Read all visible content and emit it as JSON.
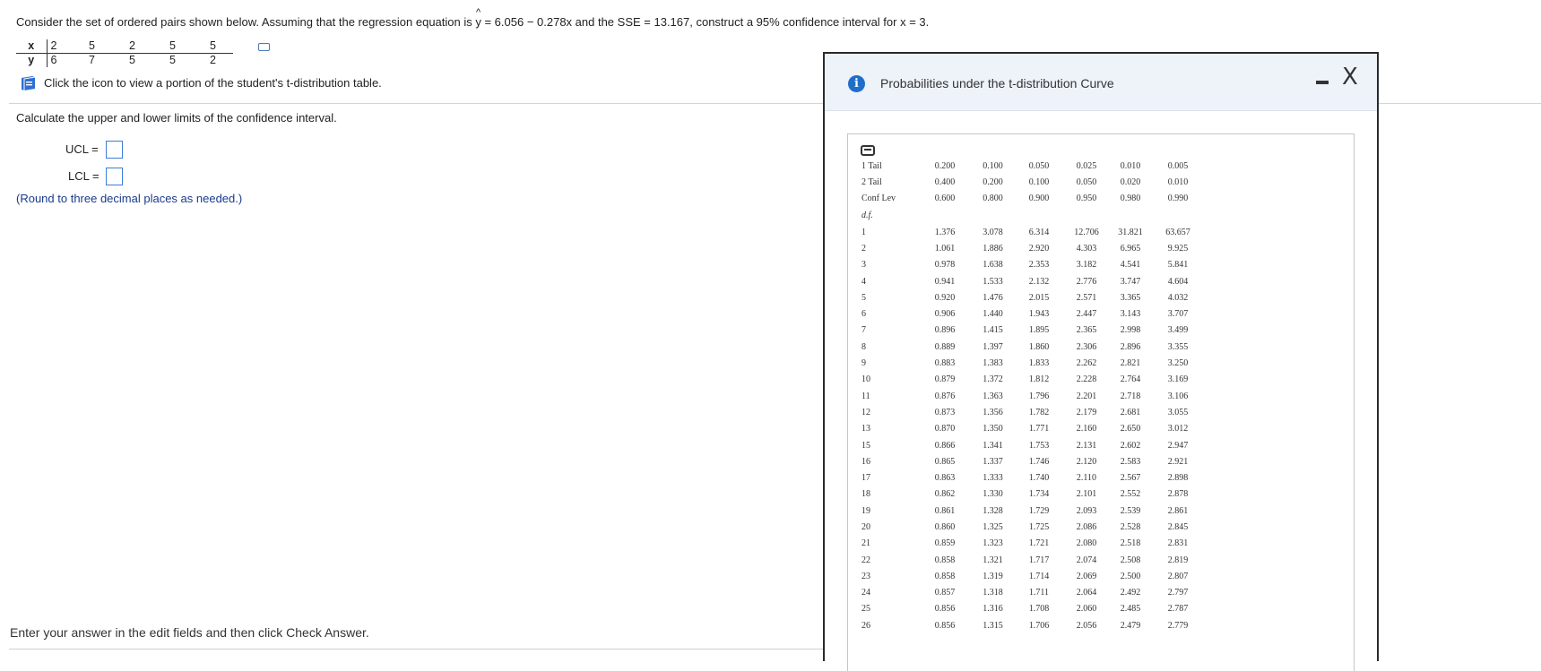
{
  "question": {
    "intro": "Consider the set of ordered pairs shown below. Assuming that the regression equation is ",
    "yhat_symbol": "y",
    "equation": " = 6.056 − 0.278x and the SSE = 13.167, construct a 95% confidence interval for x = 3."
  },
  "pairs": {
    "x_label": "x",
    "y_label": "y",
    "x": [
      "2",
      "5",
      "2",
      "5",
      "5"
    ],
    "y": [
      "6",
      "7",
      "5",
      "5",
      "2"
    ]
  },
  "table_link_text": "Click the icon to view a portion of the student's t-distribution table.",
  "calc_prompt": "Calculate the upper and lower limits of the confidence interval.",
  "answers": {
    "ucl_label": "UCL =",
    "lcl_label": "LCL =",
    "ucl_value": "",
    "lcl_value": ""
  },
  "round_note": "(Round to three decimal places as needed.)",
  "footer_hint": "Enter your answer in the edit fields and then click Check Answer.",
  "dialog": {
    "title": "Probabilities under the t-distribution Curve",
    "close_symbol": "X"
  },
  "t_table": {
    "one_tail_label": "1 Tail",
    "two_tail_label": "2 Tail",
    "conf_label": "Conf Lev",
    "df_label": "d.f.",
    "one_tail": [
      "0.200",
      "0.100",
      "0.050",
      "0.025",
      "0.010",
      "0.005"
    ],
    "two_tail": [
      "0.400",
      "0.200",
      "0.100",
      "0.050",
      "0.020",
      "0.010"
    ],
    "conf": [
      "0.600",
      "0.800",
      "0.900",
      "0.950",
      "0.980",
      "0.990"
    ],
    "rows": [
      {
        "df": "1",
        "v": [
          "1.376",
          "3.078",
          "6.314",
          "12.706",
          "31.821",
          "63.657"
        ]
      },
      {
        "df": "2",
        "v": [
          "1.061",
          "1.886",
          "2.920",
          "4.303",
          "6.965",
          "9.925"
        ]
      },
      {
        "df": "3",
        "v": [
          "0.978",
          "1.638",
          "2.353",
          "3.182",
          "4.541",
          "5.841"
        ]
      },
      {
        "df": "4",
        "v": [
          "0.941",
          "1.533",
          "2.132",
          "2.776",
          "3.747",
          "4.604"
        ]
      },
      {
        "df": "5",
        "v": [
          "0.920",
          "1.476",
          "2.015",
          "2.571",
          "3.365",
          "4.032"
        ]
      },
      {
        "df": "6",
        "v": [
          "0.906",
          "1.440",
          "1.943",
          "2.447",
          "3.143",
          "3.707"
        ]
      },
      {
        "df": "7",
        "v": [
          "0.896",
          "1.415",
          "1.895",
          "2.365",
          "2.998",
          "3.499"
        ]
      },
      {
        "df": "8",
        "v": [
          "0.889",
          "1.397",
          "1.860",
          "2.306",
          "2.896",
          "3.355"
        ]
      },
      {
        "df": "9",
        "v": [
          "0.883",
          "1.383",
          "1.833",
          "2.262",
          "2.821",
          "3.250"
        ]
      },
      {
        "df": "10",
        "v": [
          "0.879",
          "1.372",
          "1.812",
          "2.228",
          "2.764",
          "3.169"
        ]
      },
      {
        "df": "11",
        "v": [
          "0.876",
          "1.363",
          "1.796",
          "2.201",
          "2.718",
          "3.106"
        ]
      },
      {
        "df": "12",
        "v": [
          "0.873",
          "1.356",
          "1.782",
          "2.179",
          "2.681",
          "3.055"
        ]
      },
      {
        "df": "13",
        "v": [
          "0.870",
          "1.350",
          "1.771",
          "2.160",
          "2.650",
          "3.012"
        ]
      },
      {
        "df": "15",
        "v": [
          "0.866",
          "1.341",
          "1.753",
          "2.131",
          "2.602",
          "2.947"
        ]
      },
      {
        "df": "16",
        "v": [
          "0.865",
          "1.337",
          "1.746",
          "2.120",
          "2.583",
          "2.921"
        ]
      },
      {
        "df": "17",
        "v": [
          "0.863",
          "1.333",
          "1.740",
          "2.110",
          "2.567",
          "2.898"
        ]
      },
      {
        "df": "18",
        "v": [
          "0.862",
          "1.330",
          "1.734",
          "2.101",
          "2.552",
          "2.878"
        ]
      },
      {
        "df": "19",
        "v": [
          "0.861",
          "1.328",
          "1.729",
          "2.093",
          "2.539",
          "2.861"
        ]
      },
      {
        "df": "20",
        "v": [
          "0.860",
          "1.325",
          "1.725",
          "2.086",
          "2.528",
          "2.845"
        ]
      },
      {
        "df": "21",
        "v": [
          "0.859",
          "1.323",
          "1.721",
          "2.080",
          "2.518",
          "2.831"
        ]
      },
      {
        "df": "22",
        "v": [
          "0.858",
          "1.321",
          "1.717",
          "2.074",
          "2.508",
          "2.819"
        ]
      },
      {
        "df": "23",
        "v": [
          "0.858",
          "1.319",
          "1.714",
          "2.069",
          "2.500",
          "2.807"
        ]
      },
      {
        "df": "24",
        "v": [
          "0.857",
          "1.318",
          "1.711",
          "2.064",
          "2.492",
          "2.797"
        ]
      },
      {
        "df": "25",
        "v": [
          "0.856",
          "1.316",
          "1.708",
          "2.060",
          "2.485",
          "2.787"
        ]
      },
      {
        "df": "26",
        "v": [
          "0.856",
          "1.315",
          "1.706",
          "2.056",
          "2.479",
          "2.779"
        ]
      }
    ]
  }
}
